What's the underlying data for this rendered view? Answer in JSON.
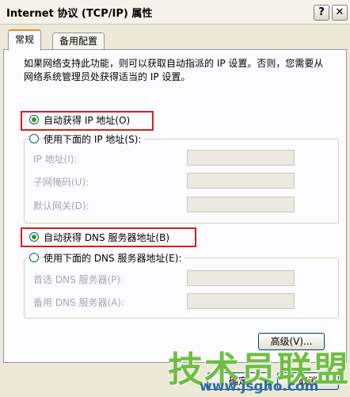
{
  "window": {
    "title": "Internet 协议 (TCP/IP) 属性",
    "help_glyph": "?",
    "close_glyph": "✕"
  },
  "tabs": [
    {
      "label": "常规"
    },
    {
      "label": "备用配置"
    }
  ],
  "description": "如果网络支持此功能，则可以获取自动指派的 IP 设置。否则，您需要从网络系统管理员处获得适当的 IP 设置。",
  "ip": {
    "auto_label": "自动获得 IP 地址(O)",
    "manual_label": "使用下面的 IP 地址(S):",
    "fields": [
      {
        "label": "IP 地址(I):",
        "value": ""
      },
      {
        "label": "子网掩码(U):",
        "value": ""
      },
      {
        "label": "默认网关(D):",
        "value": ""
      }
    ]
  },
  "dns": {
    "auto_label": "自动获得 DNS 服务器地址(B)",
    "manual_label": "使用下面的 DNS 服务器地址(E):",
    "fields": [
      {
        "label": "首选 DNS 服务器(P):",
        "value": ""
      },
      {
        "label": "备用 DNS 服务器(A):",
        "value": ""
      }
    ]
  },
  "buttons": {
    "advanced": "高级(V)...",
    "ok": "确定",
    "cancel": "取消"
  },
  "watermark": {
    "text": "技术员联盟",
    "url": "www.jsgho.com"
  },
  "colors": {
    "highlight_border": "#d81e1e",
    "radio_dot": "#21a121",
    "watermark": "#6fbe44"
  }
}
